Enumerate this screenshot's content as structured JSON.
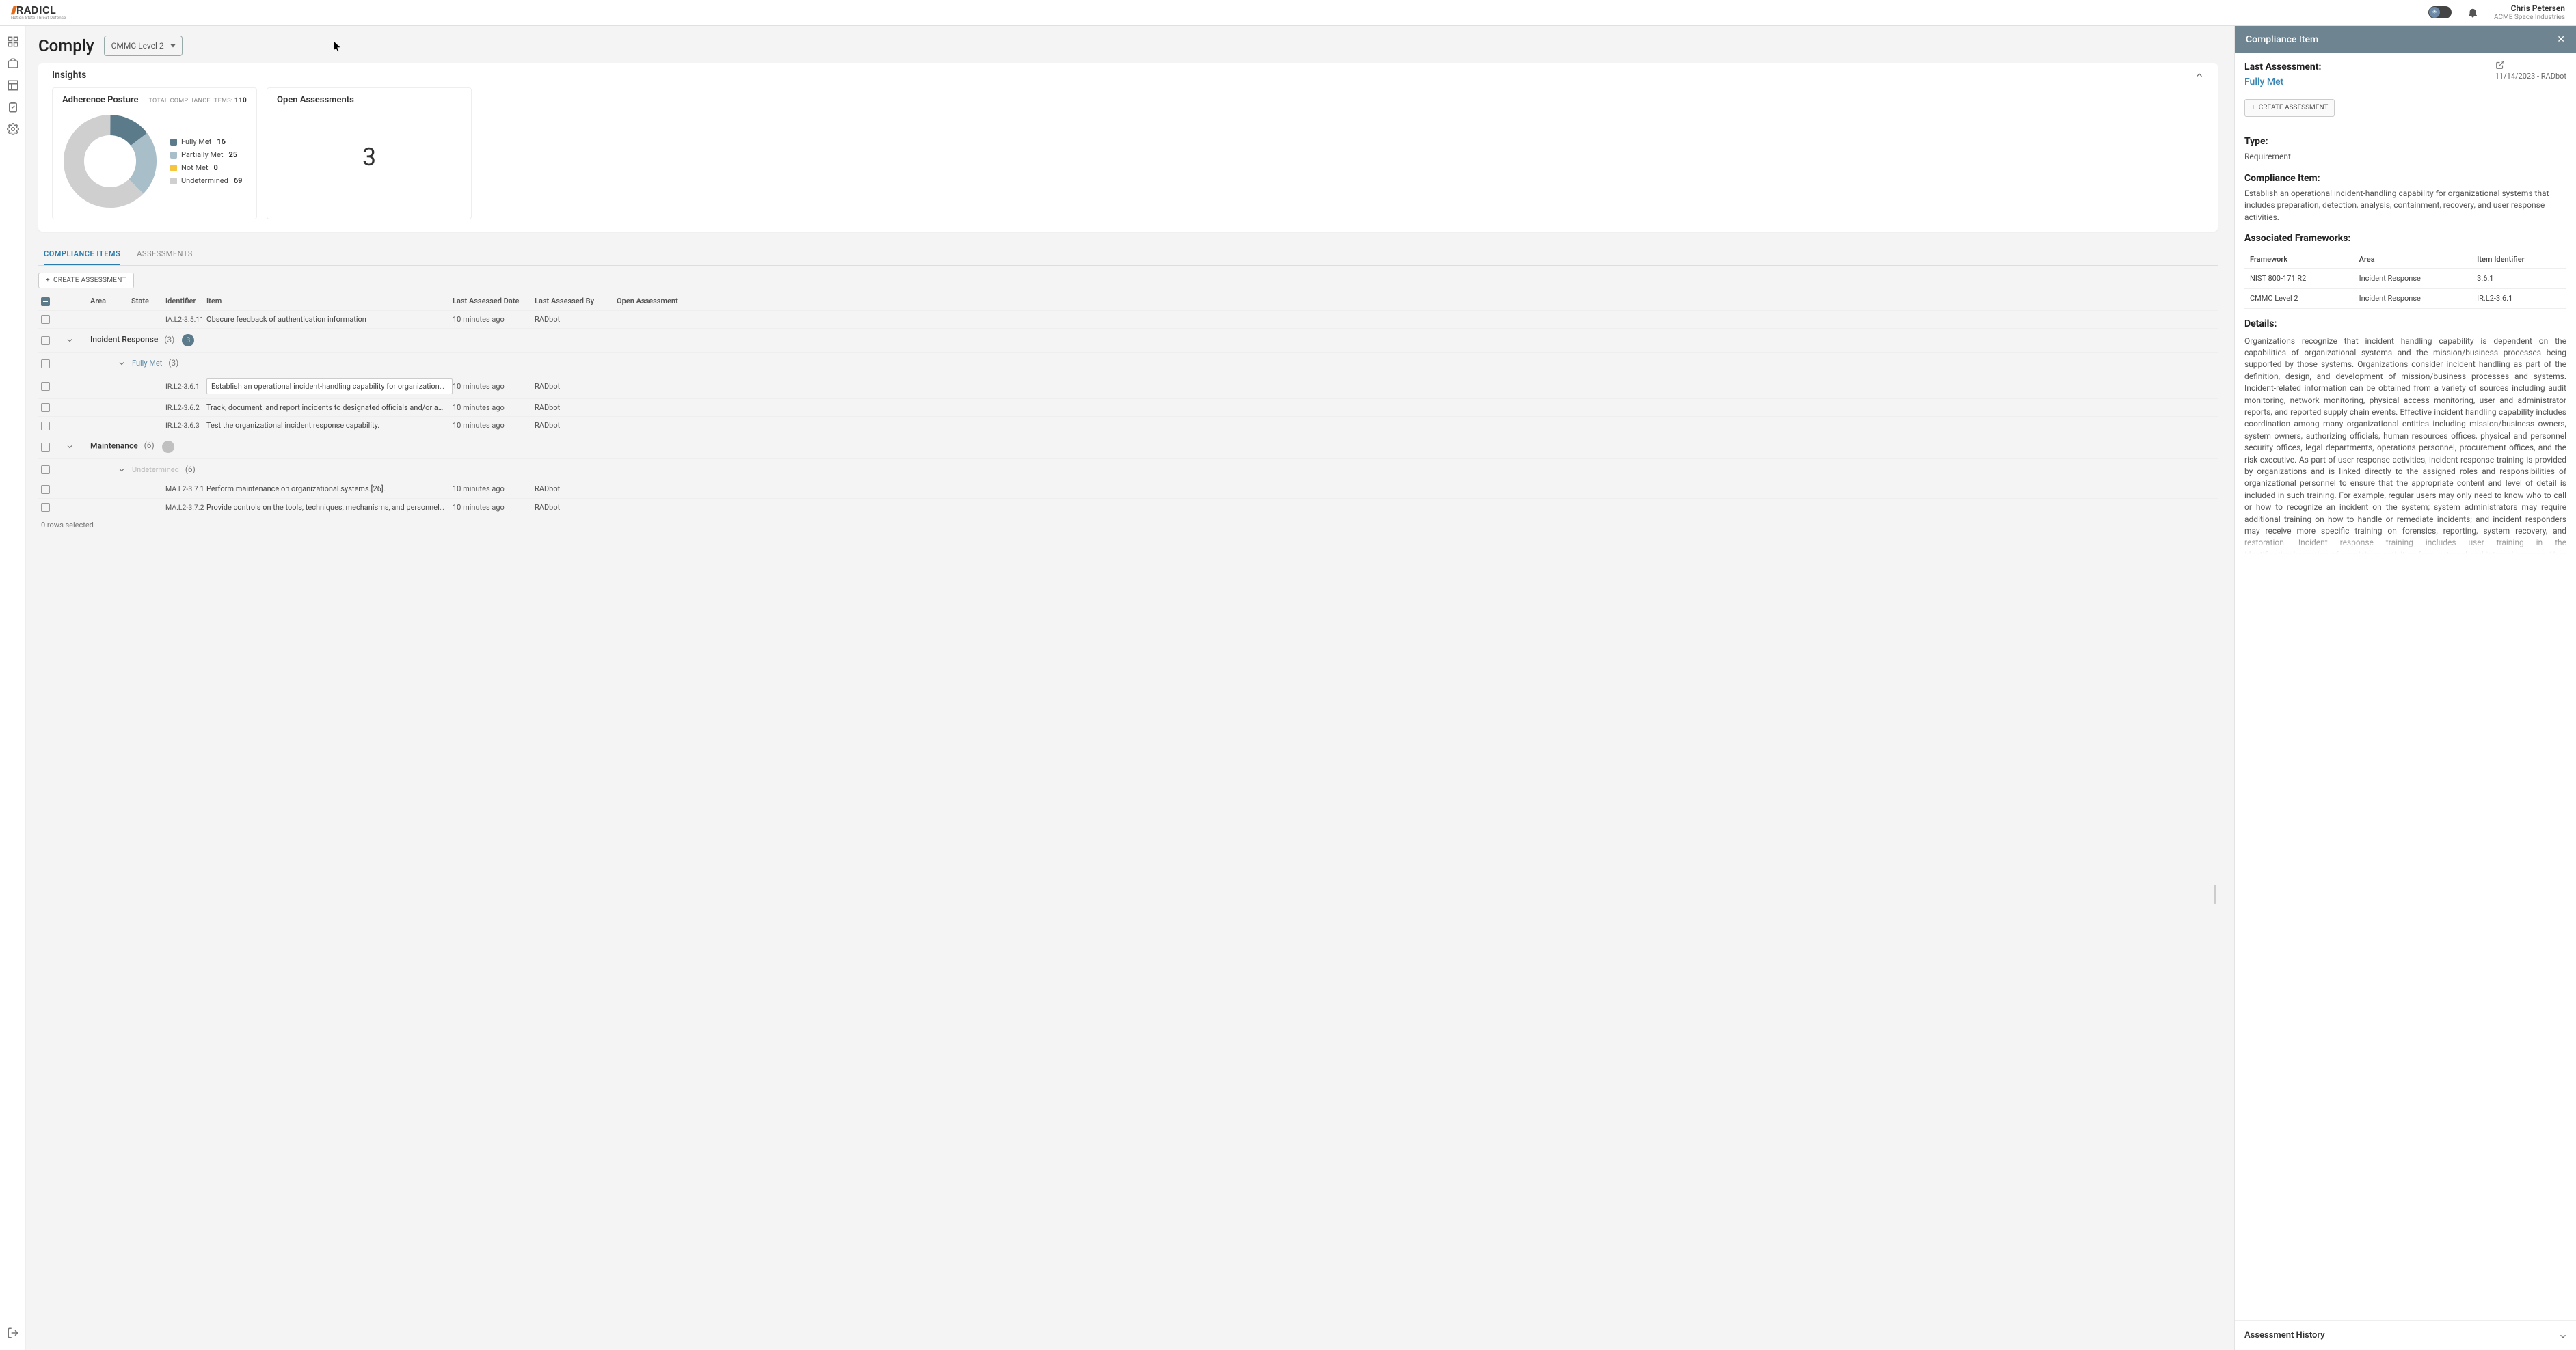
{
  "header": {
    "logo_text": "RADICL",
    "logo_tagline": "Nation State Threat Defense",
    "user_name": "Chris Petersen",
    "user_company": "ACME Space Industries"
  },
  "page": {
    "title": "Comply",
    "level": "CMMC Level 2"
  },
  "insights": {
    "title": "Insights",
    "posture_title": "Adherence Posture",
    "total_label": "TOTAL COMPLIANCE ITEMS:",
    "total_value": "110",
    "legend": {
      "full_label": "Fully Met",
      "full_val": "16",
      "partial_label": "Partially Met",
      "partial_val": "25",
      "not_label": "Not Met",
      "not_val": "0",
      "undet_label": "Undetermined",
      "undet_val": "69"
    },
    "open_title": "Open Assessments",
    "open_value": "3"
  },
  "chart_data": {
    "type": "pie",
    "title": "Adherence Posture",
    "categories": [
      "Fully Met",
      "Partially Met",
      "Not Met",
      "Undetermined"
    ],
    "values": [
      16,
      25,
      0,
      69
    ],
    "colors": [
      "#5b7a8a",
      "#a8bfca",
      "#f5c542",
      "#cfcfcf"
    ]
  },
  "tabs": {
    "items_label": "COMPLIANCE ITEMS",
    "assess_label": "ASSESSMENTS"
  },
  "buttons": {
    "create_assessment": "CREATE ASSESSMENT"
  },
  "table": {
    "headers": {
      "area": "Area",
      "state": "State",
      "identifier": "Identifier",
      "item": "Item",
      "last_date": "Last Assessed Date",
      "last_by": "Last Assessed By",
      "open": "Open Assessment"
    },
    "rows": [
      {
        "identifier": "IA.L2-3.5.11",
        "item": "Obscure feedback of authentication information",
        "date": "10 minutes ago",
        "by": "RADbot"
      }
    ],
    "group_ir": {
      "label": "Incident Response",
      "count": "(3)",
      "badge": "3"
    },
    "state_full": {
      "label": "Fully Met",
      "count": "(3)"
    },
    "ir_rows": [
      {
        "identifier": "IR.L2-3.6.1",
        "item": "Establish an operational incident-handling capability for organizational systems that in...",
        "date": "10 minutes ago",
        "by": "RADbot"
      },
      {
        "identifier": "IR.L2-3.6.2",
        "item": "Track, document, and report incidents to designated officials and/or authorities both in...",
        "date": "10 minutes ago",
        "by": "RADbot"
      },
      {
        "identifier": "IR.L2-3.6.3",
        "item": "Test the organizational incident response capability.",
        "date": "10 minutes ago",
        "by": "RADbot"
      }
    ],
    "group_ma": {
      "label": "Maintenance",
      "count": "(6)"
    },
    "state_undet": {
      "label": "Undetermined",
      "count": "(6)"
    },
    "ma_rows": [
      {
        "identifier": "MA.L2-3.7.1",
        "item": "Perform maintenance on organizational systems.[26].",
        "date": "10 minutes ago",
        "by": "RADbot"
      },
      {
        "identifier": "MA.L2-3.7.2",
        "item": "Provide controls on the tools, techniques, mechanisms, and personnel used to conduct...",
        "date": "10 minutes ago",
        "by": "RADbot"
      }
    ],
    "footer": "0 rows selected"
  },
  "panel": {
    "title": "Compliance Item",
    "last_assessment_label": "Last Assessment:",
    "last_assessment_value": "Fully Met",
    "last_assessment_date": "11/14/2023 - RADbot",
    "type_label": "Type:",
    "type_value": "Requirement",
    "compliance_item_label": "Compliance Item:",
    "compliance_item_text": "Establish an operational incident-handling capability for organizational systems that includes preparation, detection, analysis, containment, recovery, and user response activities.",
    "frameworks_label": "Associated Frameworks:",
    "fw_headers": {
      "framework": "Framework",
      "area": "Area",
      "ident": "Item Identifier"
    },
    "fw_rows": [
      {
        "framework": "NIST 800-171 R2",
        "area": "Incident Response",
        "ident": "3.6.1"
      },
      {
        "framework": "CMMC Level 2",
        "area": "Incident Response",
        "ident": "IR.L2-3.6.1"
      }
    ],
    "details_label": "Details:",
    "details_text": "Organizations recognize that incident handling capability is dependent on the capabilities of organizational systems and the mission/business processes being supported by those systems. Organizations consider incident handling as part of the definition, design, and development of mission/business processes and systems. Incident-related information can be obtained from a variety of sources including audit monitoring, network monitoring, physical access monitoring, user and administrator reports, and reported supply chain events. Effective incident handling capability includes coordination among many organizational entities including mission/business owners, system owners, authorizing officials, human resources offices, physical and personnel security offices, legal departments, operations personnel, procurement offices, and the risk executive.  As part of user response activities, incident response training is provided by organizations and is linked directly to the assigned roles and responsibilities of organizational personnel to ensure that the appropriate content and level of detail is included in such training. For example, regular users may only need to know who to call or how to recognize an incident on the system; system administrators may require additional training on how to handle or remediate incidents; and incident responders may receive more specific training on forensics, reporting, system recovery, and restoration. Incident response training includes user training in the identification/reporting of suspicious activities from external and internal sources. User response activities also includes incident response assistance which may consist of help desk support, assistance groups, and access to forensics services or consumer redress services, when required.  [SP 800-61] provides guidance on incident handling. [SP 800-86] and [SP 800-101] provide guidance on integrating forensic techniques into incident response. [SP 800-161] provides guidance on supply chain risk management.",
    "history_label": "Assessment History"
  }
}
